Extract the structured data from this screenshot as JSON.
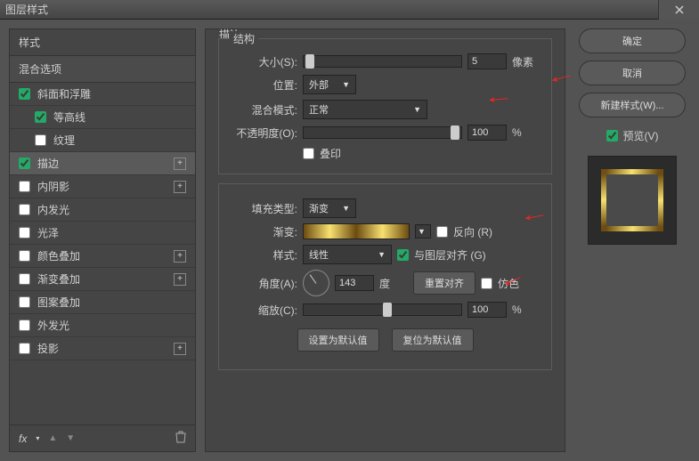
{
  "window_title": "图层样式",
  "close_icon": "close",
  "left": {
    "header": "样式",
    "subheader": "混合选项",
    "items": [
      {
        "label": "斜面和浮雕",
        "checked": true,
        "plus": false,
        "child": false
      },
      {
        "label": "等高线",
        "checked": true,
        "plus": false,
        "child": true
      },
      {
        "label": "纹理",
        "checked": false,
        "plus": false,
        "child": true
      },
      {
        "label": "描边",
        "checked": true,
        "plus": true,
        "child": false,
        "selected": true
      },
      {
        "label": "内阴影",
        "checked": false,
        "plus": true,
        "child": false
      },
      {
        "label": "内发光",
        "checked": false,
        "plus": false,
        "child": false
      },
      {
        "label": "光泽",
        "checked": false,
        "plus": false,
        "child": false
      },
      {
        "label": "颜色叠加",
        "checked": false,
        "plus": true,
        "child": false
      },
      {
        "label": "渐变叠加",
        "checked": false,
        "plus": true,
        "child": false
      },
      {
        "label": "图案叠加",
        "checked": false,
        "plus": false,
        "child": false
      },
      {
        "label": "外发光",
        "checked": false,
        "plus": false,
        "child": false
      },
      {
        "label": "投影",
        "checked": false,
        "plus": true,
        "child": false
      }
    ],
    "fx": "fx"
  },
  "center": {
    "panel_title": "描边",
    "group1_title": "结构",
    "size_label": "大小(S):",
    "size_value": "5",
    "size_unit": "像素",
    "position_label": "位置:",
    "position_value": "外部",
    "blend_label": "混合模式:",
    "blend_value": "正常",
    "opacity_label": "不透明度(O):",
    "opacity_value": "100",
    "opacity_unit": "%",
    "overprint_label": "叠印",
    "overprint_checked": false,
    "fill_type_label": "填充类型:",
    "fill_type_value": "渐变",
    "gradient_label": "渐变:",
    "reverse_label": "反向 (R)",
    "reverse_checked": false,
    "style_label": "样式:",
    "style_value": "线性",
    "align_label": "与图层对齐 (G)",
    "align_checked": true,
    "angle_label": "角度(A):",
    "angle_value": "143",
    "angle_unit": "度",
    "reset_align_btn": "重置对齐",
    "dither_label": "仿色",
    "dither_checked": false,
    "scale_label": "缩放(C):",
    "scale_value": "100",
    "scale_unit": "%",
    "default_btn": "设置为默认值",
    "reset_btn": "复位为默认值"
  },
  "right": {
    "ok": "确定",
    "cancel": "取消",
    "new_style": "新建样式(W)...",
    "preview_label": "预览(V)",
    "preview_checked": true
  }
}
